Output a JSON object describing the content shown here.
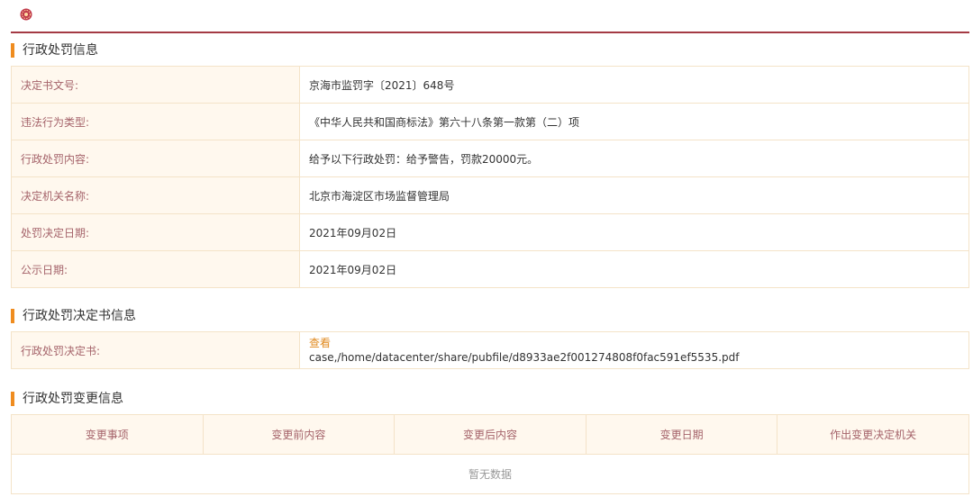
{
  "sections": {
    "penalty_info": {
      "title": "行政处罚信息",
      "rows": [
        {
          "label": "决定书文号:",
          "value": "京海市监罚字〔2021〕648号"
        },
        {
          "label": "违法行为类型:",
          "value": "《中华人民共和国商标法》第六十八条第一款第（二）项"
        },
        {
          "label": "行政处罚内容:",
          "value": "给予以下行政处罚：给予警告，罚款20000元。"
        },
        {
          "label": "决定机关名称:",
          "value": "北京市海淀区市场监督管理局"
        },
        {
          "label": "处罚决定日期:",
          "value": "2021年09月02日"
        },
        {
          "label": "公示日期:",
          "value": "2021年09月02日"
        }
      ]
    },
    "decision_doc": {
      "title": "行政处罚决定书信息",
      "label": "行政处罚决定书:",
      "link_text": "查看",
      "path": "case,/home/datacenter/share/pubfile/d8933ae2f001274808f0fac591ef5535.pdf"
    },
    "changes": {
      "title": "行政处罚变更信息",
      "headers": [
        "变更事项",
        "变更前内容",
        "变更后内容",
        "变更日期",
        "作出变更决定机关"
      ],
      "empty_text": "暂无数据"
    }
  },
  "colors": {
    "accent_bar": "#ef8c1f",
    "top_rule": "#a43a44",
    "label_text": "#a5636a",
    "label_bg": "#fff8ee",
    "border": "#f4e3c8",
    "link": "#e08a1f"
  }
}
